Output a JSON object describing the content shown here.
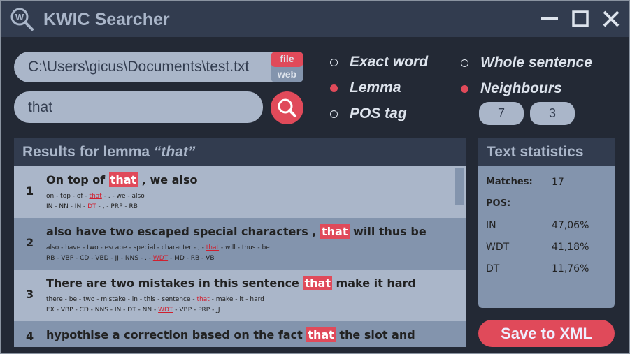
{
  "app": {
    "title": "KWIC Searcher"
  },
  "source": {
    "path": "C:\\Users\\gicus\\Documents\\test.txt",
    "file_label": "file",
    "web_label": "web",
    "selected": "file"
  },
  "query": {
    "value": "that"
  },
  "options": {
    "exact_word": "Exact word",
    "lemma": "Lemma",
    "pos_tag": "POS tag",
    "whole_sentence": "Whole sentence",
    "neighbours": "Neighbours",
    "selected_mode": "Lemma",
    "selected_context": "Neighbours",
    "neighbours_left": "7",
    "neighbours_right": "3"
  },
  "results": {
    "title_prefix": "Results for lemma ",
    "title_query": "“that”",
    "rows": [
      {
        "n": "1",
        "pre": "On top of ",
        "kw": "that",
        "post": " , we also",
        "lemmas": [
          "on - top - of - ",
          "that",
          " - , - we - also"
        ],
        "pos": [
          "IN - NN - IN - ",
          "DT",
          " - , - PRP - RB"
        ]
      },
      {
        "n": "2",
        "pre": "also have two escaped special characters , ",
        "kw": "that",
        "post": " will thus be",
        "lemmas": [
          "also - have - two - escape - special - character - , - ",
          "that",
          " - will - thus - be"
        ],
        "pos": [
          "RB - VBP - CD - VBD - JJ - NNS - , - ",
          "WDT",
          " - MD - RB - VB"
        ]
      },
      {
        "n": "3",
        "pre": "There are two mistakes in this sentence ",
        "kw": "that",
        "post": " make it hard",
        "lemmas": [
          "there - be - two - mistake - in - this - sentence - ",
          "that",
          " - make - it - hard"
        ],
        "pos": [
          "EX - VBP - CD - NNS - IN - DT - NN - ",
          "WDT",
          " - VBP - PRP - JJ"
        ]
      },
      {
        "n": "4",
        "pre": "hypothise a correction based on the fact ",
        "kw": "that",
        "post": " the slot and"
      }
    ]
  },
  "stats": {
    "title": "Text statistics",
    "matches_label": "Matches:",
    "matches": "17",
    "pos_label": "POS:",
    "rows": [
      {
        "tag": "IN",
        "pct": "47,06%"
      },
      {
        "tag": "WDT",
        "pct": "41,18%"
      },
      {
        "tag": "DT",
        "pct": "11,76%"
      }
    ]
  },
  "save_label": "Save to XML",
  "colors": {
    "bg": "#232935",
    "header": "#323c4f",
    "light": "#aab6c9",
    "mid": "#8394ad",
    "accent": "#e04a5a"
  }
}
